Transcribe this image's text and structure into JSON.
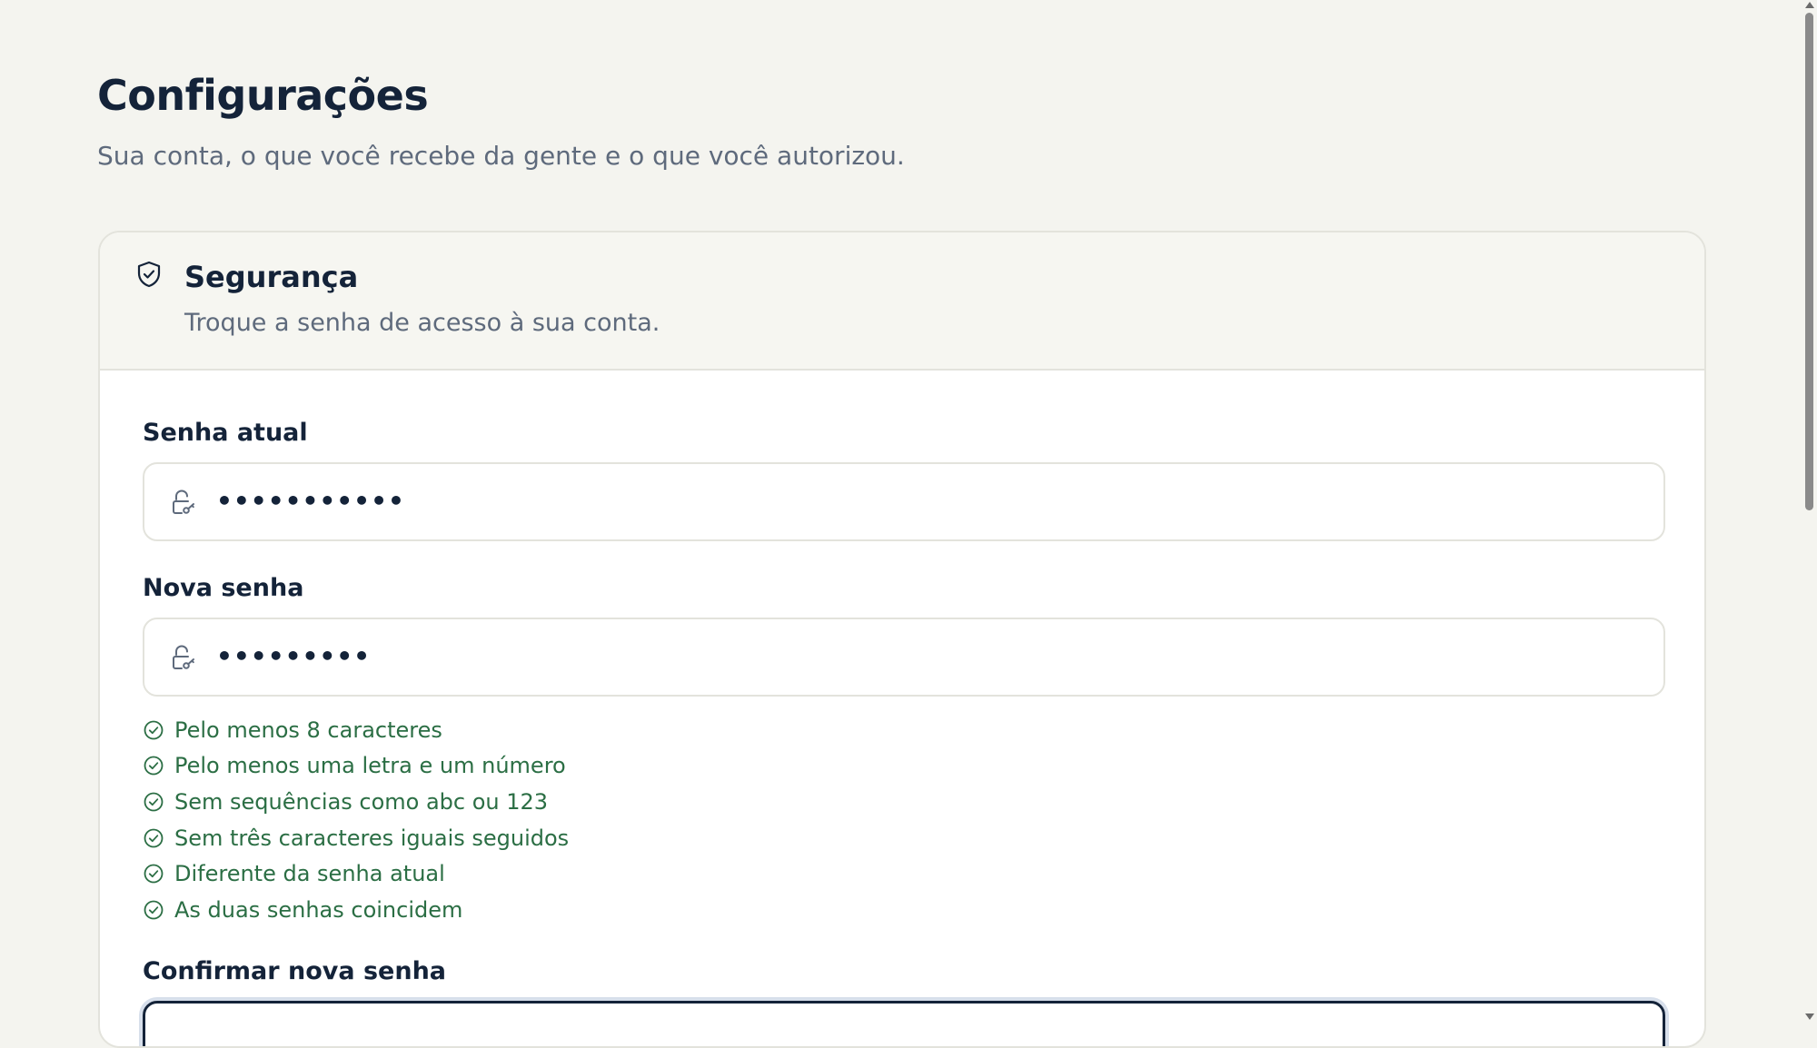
{
  "page": {
    "title": "Configurações",
    "subtitle": "Sua conta, o que você recebe da gente e o que você autorizou."
  },
  "security": {
    "icon": "shield-check-icon",
    "title": "Segurança",
    "description": "Troque a senha de acesso à sua conta.",
    "current_password": {
      "label": "Senha atual",
      "icon": "lock-key-icon",
      "value": "•••••••••••"
    },
    "new_password": {
      "label": "Nova senha",
      "icon": "lock-key-icon",
      "value": "•••••••••"
    },
    "rules": [
      {
        "text": "Pelo menos 8 caracteres",
        "icon": "check-circle-icon",
        "status": "met"
      },
      {
        "text": "Pelo menos uma letra e um número",
        "icon": "check-circle-icon",
        "status": "met"
      },
      {
        "text": "Sem sequências como abc ou 123",
        "icon": "check-circle-icon",
        "status": "met"
      },
      {
        "text": "Sem três caracteres iguais seguidos",
        "icon": "check-circle-icon",
        "status": "met"
      },
      {
        "text": "Diferente da senha atual",
        "icon": "check-circle-icon",
        "status": "met"
      },
      {
        "text": "As duas senhas coincidem",
        "icon": "check-circle-icon",
        "status": "met"
      }
    ],
    "confirm_password": {
      "label": "Confirmar nova senha",
      "value": ""
    }
  },
  "colors": {
    "background": "#f4f4ef",
    "text_primary": "#142339",
    "text_secondary": "#5e6a7c",
    "success": "#2b6e44",
    "border": "#e3e3dc"
  }
}
